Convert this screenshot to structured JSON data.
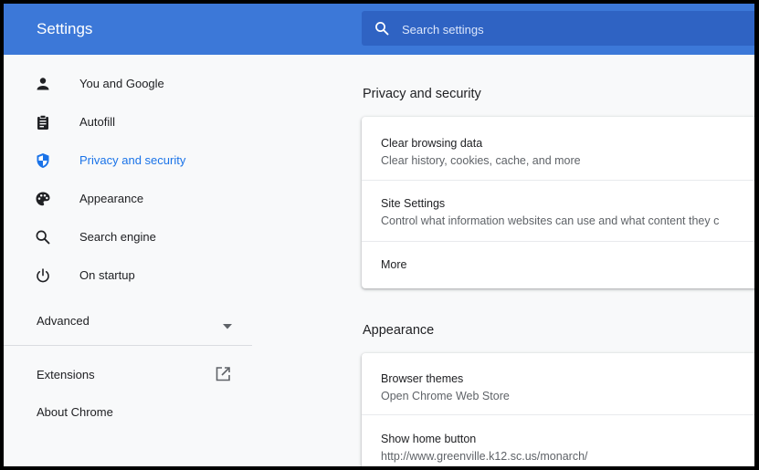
{
  "header": {
    "title": "Settings",
    "search_placeholder": "Search settings"
  },
  "sidebar": {
    "items": [
      {
        "label": "You and Google",
        "icon": "person-icon"
      },
      {
        "label": "Autofill",
        "icon": "clipboard-icon"
      },
      {
        "label": "Privacy and security",
        "icon": "shield-icon",
        "active": true
      },
      {
        "label": "Appearance",
        "icon": "palette-icon"
      },
      {
        "label": "Search engine",
        "icon": "search-icon"
      },
      {
        "label": "On startup",
        "icon": "power-icon"
      }
    ],
    "advanced_label": "Advanced",
    "extensions_label": "Extensions",
    "about_label": "About Chrome"
  },
  "privacy_section": {
    "title": "Privacy and security",
    "rows": [
      {
        "title": "Clear browsing data",
        "subtitle": "Clear history, cookies, cache, and more"
      },
      {
        "title": "Site Settings",
        "subtitle": "Control what information websites can use and what content they c"
      },
      {
        "title": "More"
      }
    ]
  },
  "appearance_section": {
    "title": "Appearance",
    "rows": [
      {
        "title": "Browser themes",
        "subtitle": "Open Chrome Web Store"
      },
      {
        "title": "Show home button",
        "subtitle": "http://www.greenville.k12.sc.us/monarch/"
      }
    ]
  },
  "colors": {
    "header": "#3c78d8",
    "accent": "#1a73e8",
    "icon": "#5f6368",
    "background": "#f8f9fa"
  }
}
